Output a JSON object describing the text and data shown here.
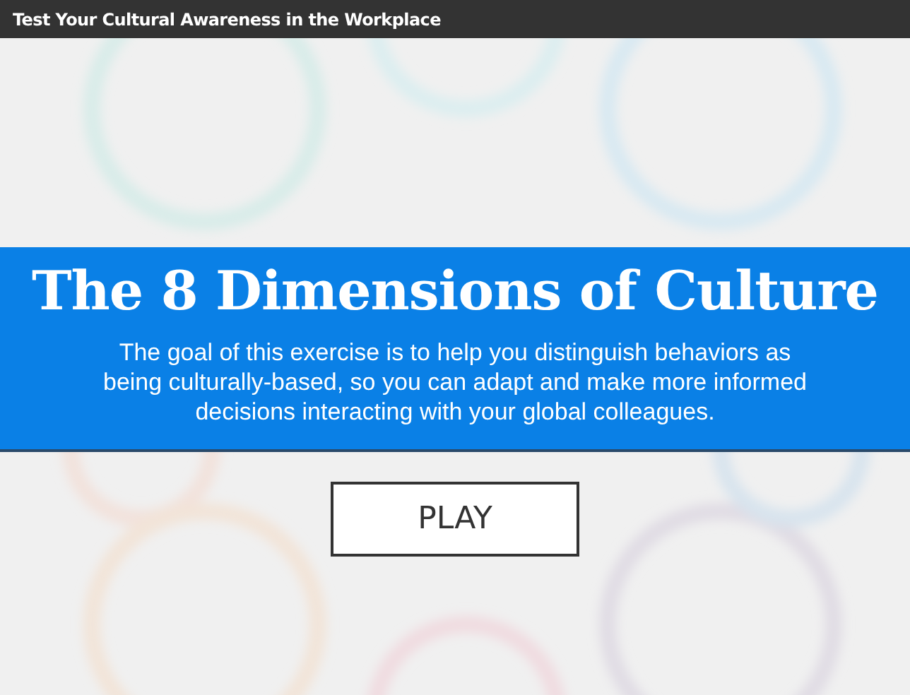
{
  "window": {
    "title": "Test Your Cultural Awareness in the Workplace"
  },
  "banner": {
    "heading": "The 8 Dimensions of Culture",
    "description": "The goal of this exercise is to help you distinguish behaviors as being culturally-based, so you can adapt and make more informed decisions interacting with your global colleagues."
  },
  "buttons": [
    "PLAY"
  ]
}
